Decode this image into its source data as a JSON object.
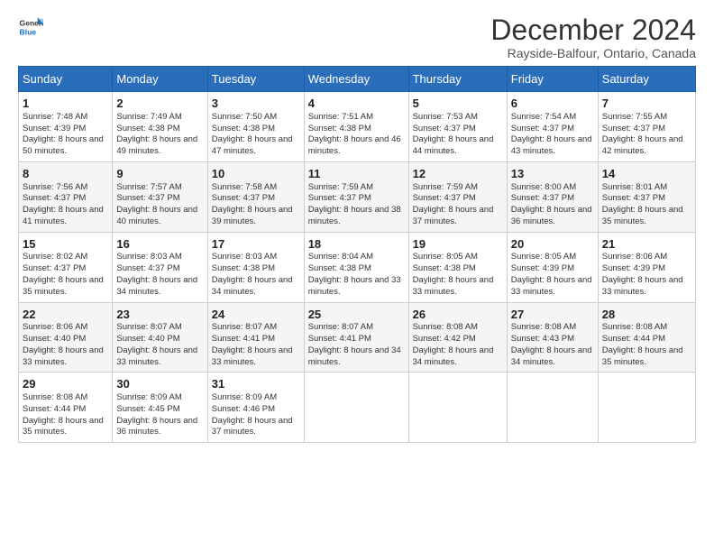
{
  "logo": {
    "line1": "General",
    "line2": "Blue"
  },
  "title": "December 2024",
  "subtitle": "Rayside-Balfour, Ontario, Canada",
  "headers": [
    "Sunday",
    "Monday",
    "Tuesday",
    "Wednesday",
    "Thursday",
    "Friday",
    "Saturday"
  ],
  "weeks": [
    [
      {
        "day": "1",
        "sunrise": "7:48 AM",
        "sunset": "4:39 PM",
        "daylight": "8 hours and 50 minutes."
      },
      {
        "day": "2",
        "sunrise": "7:49 AM",
        "sunset": "4:38 PM",
        "daylight": "8 hours and 49 minutes."
      },
      {
        "day": "3",
        "sunrise": "7:50 AM",
        "sunset": "4:38 PM",
        "daylight": "8 hours and 47 minutes."
      },
      {
        "day": "4",
        "sunrise": "7:51 AM",
        "sunset": "4:38 PM",
        "daylight": "8 hours and 46 minutes."
      },
      {
        "day": "5",
        "sunrise": "7:53 AM",
        "sunset": "4:37 PM",
        "daylight": "8 hours and 44 minutes."
      },
      {
        "day": "6",
        "sunrise": "7:54 AM",
        "sunset": "4:37 PM",
        "daylight": "8 hours and 43 minutes."
      },
      {
        "day": "7",
        "sunrise": "7:55 AM",
        "sunset": "4:37 PM",
        "daylight": "8 hours and 42 minutes."
      }
    ],
    [
      {
        "day": "8",
        "sunrise": "7:56 AM",
        "sunset": "4:37 PM",
        "daylight": "8 hours and 41 minutes."
      },
      {
        "day": "9",
        "sunrise": "7:57 AM",
        "sunset": "4:37 PM",
        "daylight": "8 hours and 40 minutes."
      },
      {
        "day": "10",
        "sunrise": "7:58 AM",
        "sunset": "4:37 PM",
        "daylight": "8 hours and 39 minutes."
      },
      {
        "day": "11",
        "sunrise": "7:59 AM",
        "sunset": "4:37 PM",
        "daylight": "8 hours and 38 minutes."
      },
      {
        "day": "12",
        "sunrise": "7:59 AM",
        "sunset": "4:37 PM",
        "daylight": "8 hours and 37 minutes."
      },
      {
        "day": "13",
        "sunrise": "8:00 AM",
        "sunset": "4:37 PM",
        "daylight": "8 hours and 36 minutes."
      },
      {
        "day": "14",
        "sunrise": "8:01 AM",
        "sunset": "4:37 PM",
        "daylight": "8 hours and 35 minutes."
      }
    ],
    [
      {
        "day": "15",
        "sunrise": "8:02 AM",
        "sunset": "4:37 PM",
        "daylight": "8 hours and 35 minutes."
      },
      {
        "day": "16",
        "sunrise": "8:03 AM",
        "sunset": "4:37 PM",
        "daylight": "8 hours and 34 minutes."
      },
      {
        "day": "17",
        "sunrise": "8:03 AM",
        "sunset": "4:38 PM",
        "daylight": "8 hours and 34 minutes."
      },
      {
        "day": "18",
        "sunrise": "8:04 AM",
        "sunset": "4:38 PM",
        "daylight": "8 hours and 33 minutes."
      },
      {
        "day": "19",
        "sunrise": "8:05 AM",
        "sunset": "4:38 PM",
        "daylight": "8 hours and 33 minutes."
      },
      {
        "day": "20",
        "sunrise": "8:05 AM",
        "sunset": "4:39 PM",
        "daylight": "8 hours and 33 minutes."
      },
      {
        "day": "21",
        "sunrise": "8:06 AM",
        "sunset": "4:39 PM",
        "daylight": "8 hours and 33 minutes."
      }
    ],
    [
      {
        "day": "22",
        "sunrise": "8:06 AM",
        "sunset": "4:40 PM",
        "daylight": "8 hours and 33 minutes."
      },
      {
        "day": "23",
        "sunrise": "8:07 AM",
        "sunset": "4:40 PM",
        "daylight": "8 hours and 33 minutes."
      },
      {
        "day": "24",
        "sunrise": "8:07 AM",
        "sunset": "4:41 PM",
        "daylight": "8 hours and 33 minutes."
      },
      {
        "day": "25",
        "sunrise": "8:07 AM",
        "sunset": "4:41 PM",
        "daylight": "8 hours and 34 minutes."
      },
      {
        "day": "26",
        "sunrise": "8:08 AM",
        "sunset": "4:42 PM",
        "daylight": "8 hours and 34 minutes."
      },
      {
        "day": "27",
        "sunrise": "8:08 AM",
        "sunset": "4:43 PM",
        "daylight": "8 hours and 34 minutes."
      },
      {
        "day": "28",
        "sunrise": "8:08 AM",
        "sunset": "4:44 PM",
        "daylight": "8 hours and 35 minutes."
      }
    ],
    [
      {
        "day": "29",
        "sunrise": "8:08 AM",
        "sunset": "4:44 PM",
        "daylight": "8 hours and 35 minutes."
      },
      {
        "day": "30",
        "sunrise": "8:09 AM",
        "sunset": "4:45 PM",
        "daylight": "8 hours and 36 minutes."
      },
      {
        "day": "31",
        "sunrise": "8:09 AM",
        "sunset": "4:46 PM",
        "daylight": "8 hours and 37 minutes."
      },
      null,
      null,
      null,
      null
    ]
  ],
  "labels": {
    "sunrise": "Sunrise:",
    "sunset": "Sunset:",
    "daylight": "Daylight:"
  }
}
